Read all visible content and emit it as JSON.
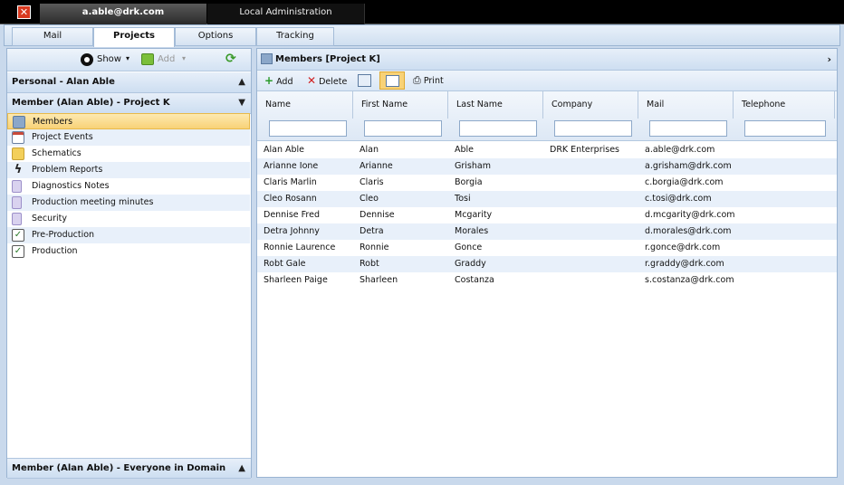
{
  "window": {
    "user_tab": "a.able@drk.com",
    "admin_tab": "Local Administration"
  },
  "module_tabs": [
    "Mail",
    "Projects",
    "Options",
    "Tracking"
  ],
  "left_toolbar": {
    "show_label": "Show",
    "add_label": "Add"
  },
  "personal_header": "Personal - Alan Able",
  "member_header": "Member (Alan Able) - Project K",
  "nav_items": [
    {
      "label": "Members",
      "icon": "members-icon"
    },
    {
      "label": "Project Events",
      "icon": "calendar-icon"
    },
    {
      "label": "Schematics",
      "icon": "folder-icon"
    },
    {
      "label": "Problem Reports",
      "icon": "lightning-icon"
    },
    {
      "label": "Diagnostics Notes",
      "icon": "note-icon"
    },
    {
      "label": "Production meeting minutes",
      "icon": "note-icon"
    },
    {
      "label": "Security",
      "icon": "note-icon"
    },
    {
      "label": "Pre-Production",
      "icon": "clipboard-icon"
    },
    {
      "label": "Production",
      "icon": "clipboard-icon"
    }
  ],
  "footer_header": "Member (Alan Able) - Everyone in Domain",
  "right_header": "Members [Project K]",
  "right_toolbar": {
    "add": "Add",
    "delete": "Delete",
    "print": "Print"
  },
  "columns": [
    "Name",
    "First Name",
    "Last Name",
    "Company",
    "Mail",
    "Telephone"
  ],
  "rows": [
    [
      "Alan Able",
      "Alan",
      "Able",
      "DRK Enterprises",
      "a.able@drk.com",
      ""
    ],
    [
      "Arianne Ione",
      "Arianne",
      "Grisham",
      "",
      "a.grisham@drk.com",
      ""
    ],
    [
      "Claris Marlin",
      "Claris",
      "Borgia",
      "",
      "c.borgia@drk.com",
      ""
    ],
    [
      "Cleo Rosann",
      "Cleo",
      "Tosi",
      "",
      "c.tosi@drk.com",
      ""
    ],
    [
      "Dennise Fred",
      "Dennise",
      "Mcgarity",
      "",
      "d.mcgarity@drk.com",
      ""
    ],
    [
      "Detra Johnny",
      "Detra",
      "Morales",
      "",
      "d.morales@drk.com",
      ""
    ],
    [
      "Ronnie Laurence",
      "Ronnie",
      "Gonce",
      "",
      "r.gonce@drk.com",
      ""
    ],
    [
      "Robt Gale",
      "Robt",
      "Graddy",
      "",
      "r.graddy@drk.com",
      ""
    ],
    [
      "Sharleen Paige",
      "Sharleen",
      "Costanza",
      "",
      "s.costanza@drk.com",
      ""
    ]
  ],
  "colors": {
    "selection": "#f8d277",
    "header_bg": "#cddef1",
    "close_red": "#d9391f"
  }
}
